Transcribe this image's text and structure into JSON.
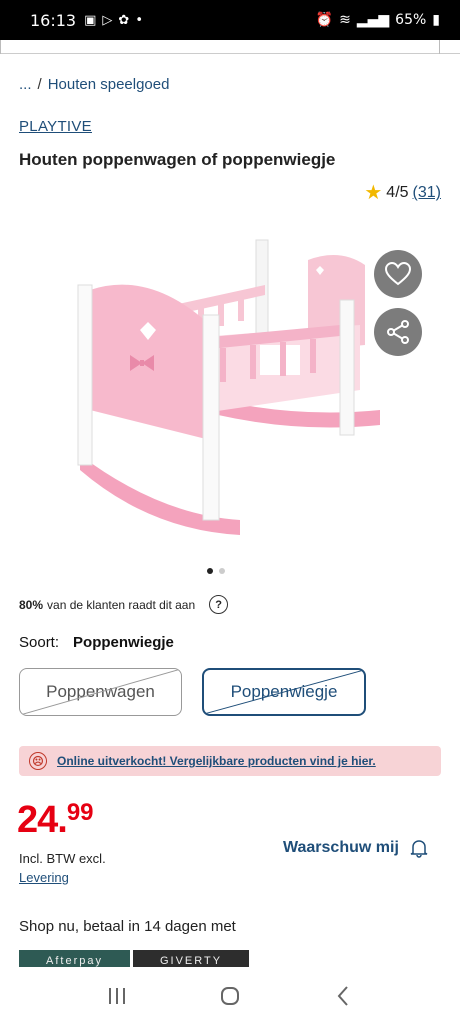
{
  "status_bar": {
    "time": "16:13",
    "battery": "65%",
    "left_icons": [
      "gallery-icon",
      "play-icon",
      "flower-icon",
      "dot-icon"
    ],
    "right_icons": [
      "alarm-icon",
      "wifi-icon",
      "signal-icon",
      "battery-icon"
    ]
  },
  "breadcrumb": {
    "ellipsis": "...",
    "separator": "/",
    "current": "Houten speelgoed"
  },
  "product": {
    "brand": "PLAYTIVE",
    "title": "Houten poppenwagen of poppenwiegje",
    "rating": "4/5",
    "review_count": "(31)",
    "image_alt": "pink wooden doll cradle",
    "carousel_total": 2,
    "carousel_active": 1
  },
  "recommend": {
    "percent": "80%",
    "text": "van de klanten raadt dit aan",
    "help": "?"
  },
  "variant": {
    "label": "Soort:",
    "selected": "Poppenwiegje",
    "options": [
      "Poppenwagen",
      "Poppenwiegje"
    ]
  },
  "alert": {
    "text": "Online uitverkocht! Vergelijkbare producten vind je hier."
  },
  "price": {
    "main": "24.",
    "cents": "99",
    "vat": "Incl. BTW excl.",
    "delivery": "Levering"
  },
  "notify": {
    "label": "Waarschuw mij"
  },
  "payment": {
    "shop_now": "Shop nu, betaal in 14 dagen met",
    "logos": [
      "Afterpay",
      "GIVERTY"
    ]
  },
  "colors": {
    "brand_blue": "#1f4e79",
    "price_red": "#e60012",
    "alert_bg": "#f7d3d6"
  }
}
